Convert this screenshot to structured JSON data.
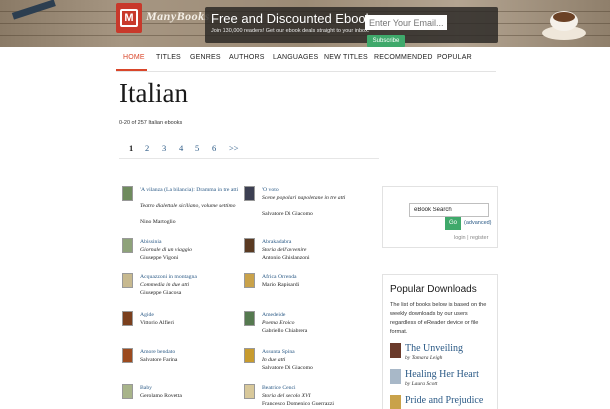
{
  "header": {
    "logo_letter": "M",
    "logo_text": "ManyBooks",
    "signup_title": "Free and Discounted Ebooks",
    "signup_sub": "Join 130,000 readers! Get our ebook deals straight to your inbox.",
    "email_placeholder": "Enter Your Email...",
    "subscribe_label": "Subscribe"
  },
  "nav": {
    "items": [
      "HOME",
      "TITLES",
      "GENRES",
      "AUTHORS",
      "LANGUAGES",
      "NEW TITLES",
      "RECOMMENDED",
      "POPULAR"
    ],
    "active": "HOME"
  },
  "page": {
    "title": "Italian",
    "count": "0-20 of 257 Italian ebooks"
  },
  "pager": {
    "pages": [
      "1",
      "2",
      "3",
      "4",
      "5",
      "6",
      ">>"
    ],
    "current": "1"
  },
  "books": [
    {
      "title": "'A vilanza (La bilancia): Dramma in tre atti",
      "subtitle": "Teatro dialettale siciliano, volume settimo",
      "author": "Nino Martoglio",
      "cover_color": "#6f8b5e"
    },
    {
      "title": "'O voto",
      "subtitle": "Scene popolari napoletane in tre atti",
      "author": "Salvatore Di Giacomo",
      "cover_color": "#3c3f52"
    },
    {
      "title": "Abissinia",
      "subtitle": "Giornale di un viaggio",
      "author": "Giuseppe Vigoni",
      "cover_color": "#8ea27a"
    },
    {
      "title": "Abrakadabra",
      "subtitle": "Storia dell'avvenire",
      "author": "Antonio Ghislanzoni",
      "cover_color": "#5a3a22"
    },
    {
      "title": "Acquazzoni in montagna",
      "subtitle": "Commedia in due atti",
      "author": "Giuseppe Giacosa",
      "cover_color": "#c7b98f"
    },
    {
      "title": "Africa Orrenda",
      "subtitle": "",
      "author": "Mario Rapisardi",
      "cover_color": "#c9a24a"
    },
    {
      "title": "Agide",
      "subtitle": "",
      "author": "Vittorio Alfieri",
      "cover_color": "#7a3f1d"
    },
    {
      "title": "Amedeide",
      "subtitle": "Poema Eroico",
      "author": "Gabriello Chiabrera",
      "cover_color": "#55794f"
    },
    {
      "title": "Amore bendato",
      "subtitle": "",
      "author": "Salvatore Farina",
      "cover_color": "#9b4a1e"
    },
    {
      "title": "Assunta Spina",
      "subtitle": "In due atti",
      "author": "Salvatore Di Giacomo",
      "cover_color": "#c79b2e"
    },
    {
      "title": "Baby",
      "subtitle": "",
      "author": "Gerolamo Rovetta",
      "cover_color": "#a8b48a"
    },
    {
      "title": "Beatrice Cenci",
      "subtitle": "Storia del secolo XVI",
      "author": "Francesco Domenico Guerrazzi",
      "cover_color": "#d8c89a"
    }
  ],
  "search": {
    "value": "eBook Search",
    "go_label": "Go",
    "advanced_label": "(advanced)",
    "login_label": "login | register"
  },
  "popular": {
    "title": "Popular Downloads",
    "description": "The list of books below is based on the weekly downloads by our users regardless of eReader device or file format.",
    "books": [
      {
        "title": "The Unveiling",
        "author": "by Tamara Leigh",
        "cover_color": "#6a3a2a"
      },
      {
        "title": "Healing Her Heart",
        "author": "by Laura Scott",
        "cover_color": "#a8b8c8"
      },
      {
        "title": "Pride and Prejudice",
        "author": "",
        "cover_color": "#c9a24a"
      }
    ]
  },
  "colors": {
    "accent": "#d9462a",
    "link": "#2b5a86",
    "button": "#3fa96b"
  }
}
